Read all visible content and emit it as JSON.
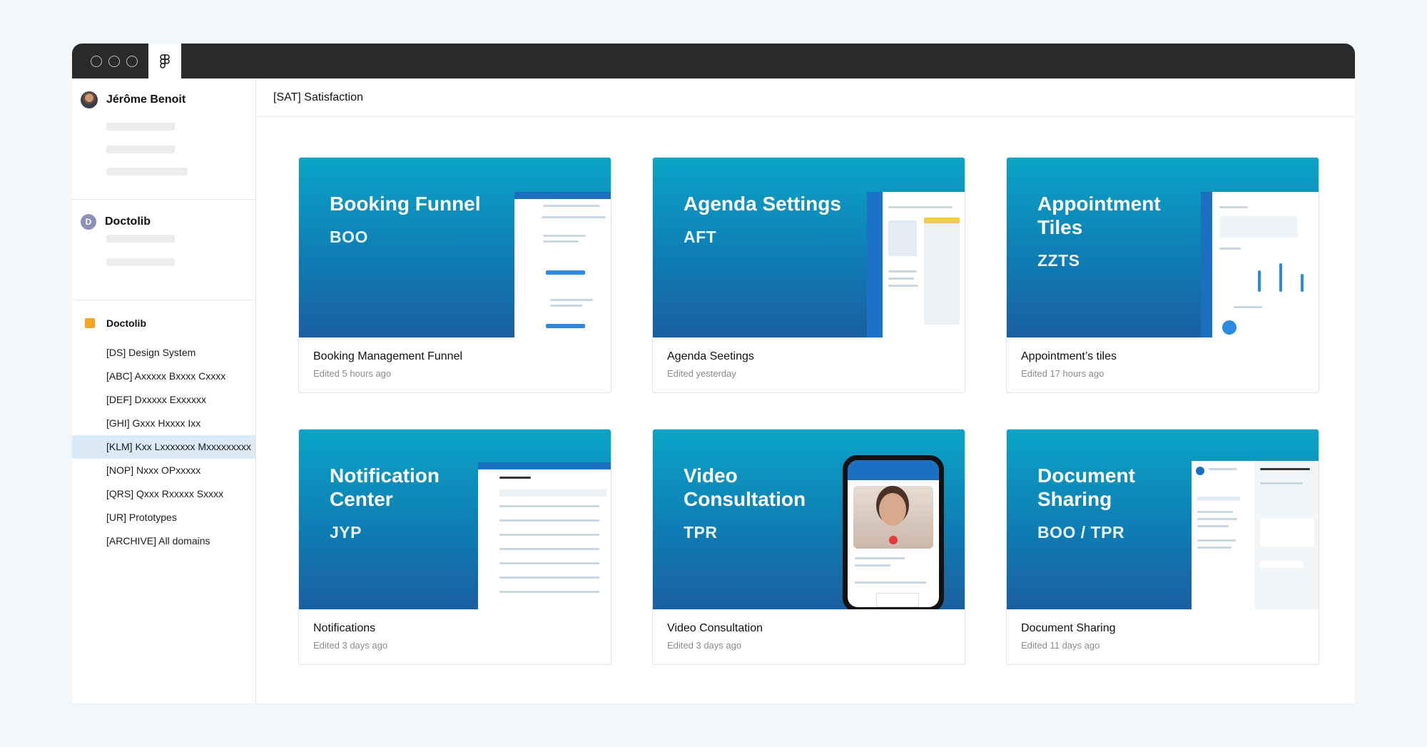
{
  "window": {
    "app_icon": "figma-icon"
  },
  "sidebar": {
    "user": {
      "name": "Jérôme Benoit"
    },
    "team": {
      "initial": "D",
      "name": "Doctolib"
    },
    "project_group": {
      "name": "Doctolib",
      "color": "#f5a623",
      "items": [
        {
          "label": "[DS] Design System",
          "active": false
        },
        {
          "label": "[ABC] Axxxxx Bxxxx Cxxxx",
          "active": false
        },
        {
          "label": "[DEF] Dxxxxx Exxxxxx",
          "active": false
        },
        {
          "label": "[GHI] Gxxx Hxxxx Ixx",
          "active": false
        },
        {
          "label": "[KLM] Kxx Lxxxxxxx Mxxxxxxxxx",
          "active": true
        },
        {
          "label": "[NOP] Nxxx OPxxxxx",
          "active": false
        },
        {
          "label": "[QRS] Qxxx Rxxxxx Sxxxx",
          "active": false
        },
        {
          "label": "[UR] Prototypes",
          "active": false
        },
        {
          "label": "[ARCHIVE] All domains",
          "active": false
        }
      ]
    }
  },
  "main": {
    "title": "[SAT] Satisfaction",
    "files": [
      {
        "thumb_title": "Booking Funnel",
        "code": "BOO",
        "name": "Booking Management Funnel",
        "edited": "Edited 5 hours ago"
      },
      {
        "thumb_title": "Agenda Settings",
        "code": "AFT",
        "name": "Agenda Seetings",
        "edited": "Edited yesterday"
      },
      {
        "thumb_title": "Appointment Tiles",
        "code": "ZZTS",
        "name": "Appointment’s tiles",
        "edited": "Edited 17 hours ago"
      },
      {
        "thumb_title": "Notification Center",
        "code": "JYP",
        "name": "Notifications",
        "edited": "Edited 3 days ago"
      },
      {
        "thumb_title": "Video Consultation",
        "code": "TPR",
        "name": "Video Consultation",
        "edited": "Edited 3 days ago"
      },
      {
        "thumb_title": "Document Sharing",
        "code": "BOO / TPR",
        "name": "Document Sharing",
        "edited": "Edited 11 days ago"
      }
    ]
  },
  "colors": {
    "thumb_gradient_top": "#0aa4c6",
    "thumb_gradient_bottom": "#1a5fa0",
    "active_row": "#daebf7"
  }
}
